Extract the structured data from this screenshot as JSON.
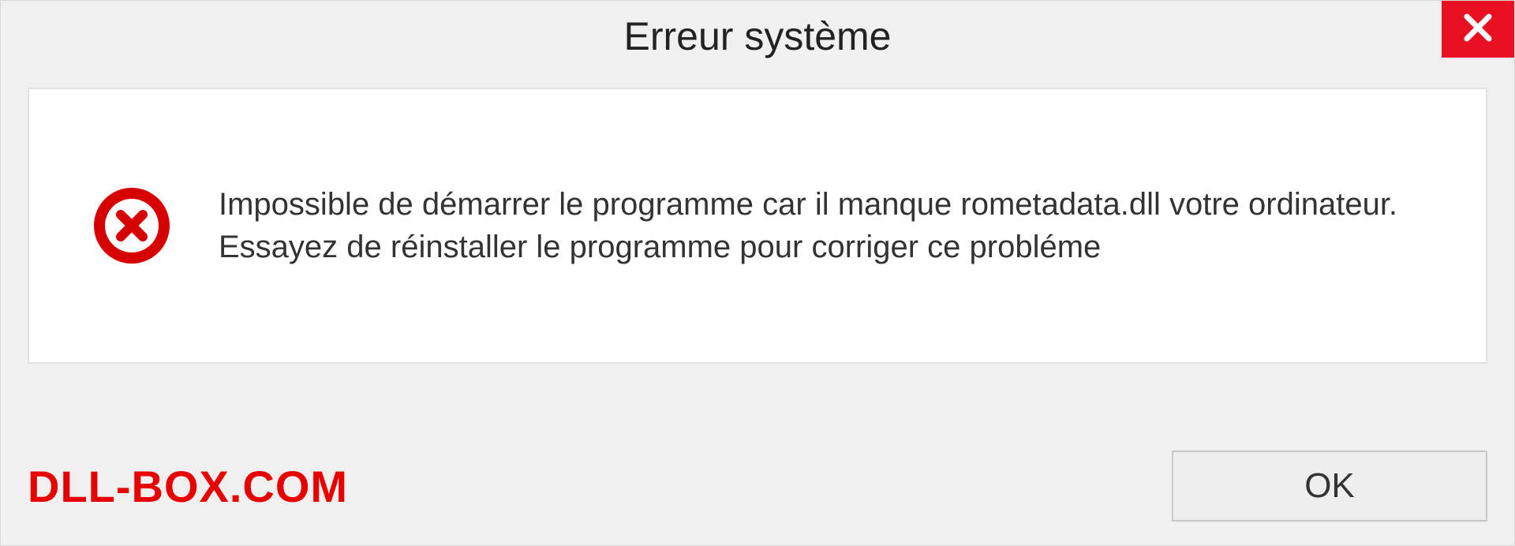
{
  "dialog": {
    "title": "Erreur système",
    "message": "Impossible de démarrer le programme car il manque rometadata.dll votre ordinateur. Essayez de réinstaller le programme pour corriger ce probléme",
    "ok_label": "OK",
    "brand": "DLL-BOX.COM"
  },
  "colors": {
    "close_bg": "#e81123",
    "brand_color": "#e60000",
    "error_icon": "#d60000"
  }
}
